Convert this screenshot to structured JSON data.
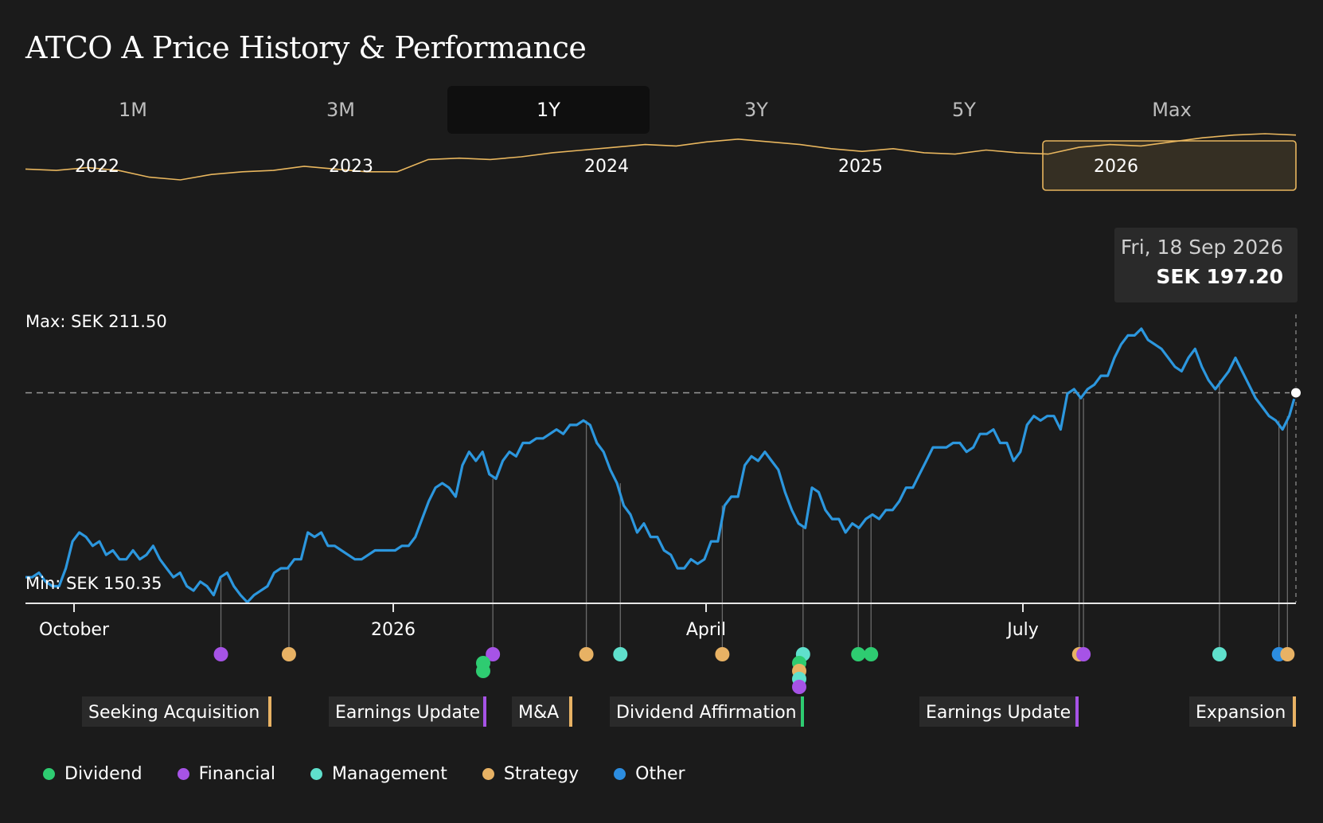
{
  "page": {
    "title": "ATCO A Price History & Performance"
  },
  "tabs": [
    {
      "label": "1M",
      "active": false
    },
    {
      "label": "3M",
      "active": false
    },
    {
      "label": "1Y",
      "active": true
    },
    {
      "label": "3Y",
      "active": false
    },
    {
      "label": "5Y",
      "active": false
    },
    {
      "label": "Max",
      "active": false
    }
  ],
  "tooltip": {
    "date": "Fri, 18 Sep 2026",
    "price": "SEK 197.20"
  },
  "stats": {
    "max_label": "Max: SEK 211.50",
    "min_label": "Min: SEK 150.35"
  },
  "colors": {
    "line": "#2c97de",
    "navigator": "#e8b65e",
    "Dividend": "#2ecc71",
    "Financial": "#a653e6",
    "Management": "#5fe0cc",
    "Strategy": "#e8b264",
    "Other": "#2c8de0"
  },
  "legend": [
    "Dividend",
    "Financial",
    "Management",
    "Strategy",
    "Other"
  ],
  "chart_data": [
    {
      "type": "line",
      "title": "",
      "x_ticks": [
        "October",
        "2026",
        "April",
        "July"
      ],
      "ylim": [
        150.35,
        211.5
      ],
      "grid": false,
      "reference_line": 197.2,
      "series": [
        {
          "values": [
            156,
            156,
            157,
            155,
            154,
            154,
            158,
            164,
            166,
            165,
            163,
            164,
            161,
            162,
            160,
            160,
            162,
            160,
            161,
            163,
            160,
            158,
            156,
            157,
            154,
            153,
            155,
            154,
            152,
            156,
            157,
            154,
            152,
            150.4,
            152,
            153,
            154,
            157,
            158,
            158,
            160,
            160,
            166,
            165,
            166,
            163,
            163,
            162,
            161,
            160,
            160,
            161,
            162,
            162,
            162,
            162,
            163,
            163,
            165,
            169,
            173,
            176,
            177,
            176,
            174,
            181,
            184,
            182,
            184,
            179,
            178,
            182,
            184,
            183,
            186,
            186,
            187,
            187,
            188,
            189,
            188,
            190,
            190,
            191,
            190,
            186,
            184,
            180,
            177,
            172,
            170,
            166,
            168,
            165,
            165,
            162,
            161,
            158,
            158,
            160,
            159,
            160,
            164,
            164,
            172,
            174,
            174,
            181,
            183,
            182,
            184,
            182,
            180,
            175,
            171,
            168,
            167,
            176,
            175,
            171,
            169,
            169,
            166,
            168,
            167,
            169,
            170,
            169,
            171,
            171,
            173,
            176,
            176,
            179,
            182,
            185,
            185,
            185,
            186,
            186,
            184,
            185,
            188,
            188,
            189,
            186,
            186,
            182,
            184,
            190,
            192,
            191,
            192,
            192,
            189,
            197,
            198,
            196,
            198,
            199,
            201,
            201,
            205,
            208,
            210,
            210,
            211.5,
            209,
            208,
            207,
            205,
            203,
            202,
            205,
            207,
            203,
            200,
            198,
            200,
            202,
            205,
            202,
            199,
            196,
            194,
            192,
            191,
            189,
            192,
            197.2
          ]
        }
      ]
    },
    {
      "type": "area",
      "title": "",
      "x_ticks": [
        "2022",
        "2023",
        "2024",
        "2025",
        "2026"
      ],
      "selected_range": "2026",
      "series": [
        {
          "values": [
            158,
            157,
            159,
            157,
            152,
            150,
            154,
            156,
            157,
            160,
            158,
            156,
            156,
            165,
            166,
            165,
            167,
            170,
            172,
            174,
            176,
            175,
            178,
            180,
            178,
            176,
            173,
            171,
            173,
            170,
            169,
            172,
            170,
            169,
            174,
            176,
            175,
            178,
            181,
            183,
            184,
            183
          ]
        }
      ]
    }
  ],
  "events": [
    {
      "label": "Seeking Acquisition",
      "category": "Strategy"
    },
    {
      "label": "Earnings Update",
      "category": "Financial"
    },
    {
      "label": "M&A",
      "category": "Strategy"
    },
    {
      "label": "Dividend Affirmation",
      "category": "Dividend"
    },
    {
      "label": "Earnings Update",
      "category": "Financial"
    },
    {
      "label": "Expansion",
      "category": "Strategy"
    }
  ]
}
